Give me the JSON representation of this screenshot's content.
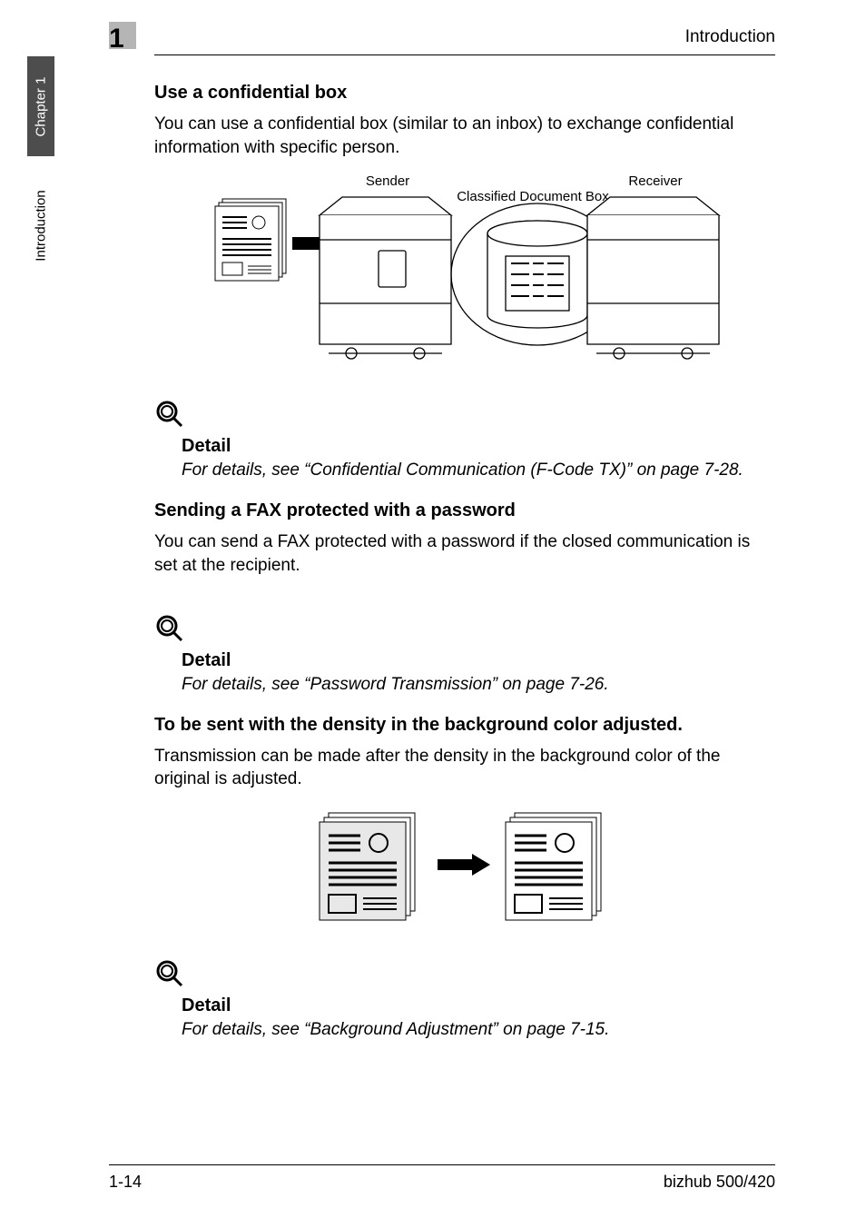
{
  "header": {
    "chapter_number": "1",
    "title": "Introduction"
  },
  "sidebar": {
    "chapter_label": "Chapter 1",
    "section_label": "Introduction"
  },
  "sections": {
    "s1": {
      "heading": "Use a confidential box",
      "body": "You can use a confidential box (similar to an inbox) to exchange confidential information with specific person.",
      "diagram_labels": {
        "sender": "Sender",
        "receiver": "Receiver",
        "box": "Classified Document Box"
      },
      "detail_title": "Detail",
      "detail_text": "For details, see “Confidential Communication (F-Code TX)” on page 7-28."
    },
    "s2": {
      "heading": "Sending a FAX protected with a password",
      "body": "You can send a FAX protected with a password if the closed communication is set at the recipient.",
      "detail_title": "Detail",
      "detail_text": "For details, see “Password Transmission” on page 7-26."
    },
    "s3": {
      "heading": "To be sent with the density in the background color adjusted.",
      "body": "Transmission can be made after the density in the background color of the original is adjusted.",
      "detail_title": "Detail",
      "detail_text": "For details, see “Background Adjustment” on page 7-15."
    }
  },
  "footer": {
    "page_number": "1-14",
    "model": "bizhub 500/420"
  }
}
